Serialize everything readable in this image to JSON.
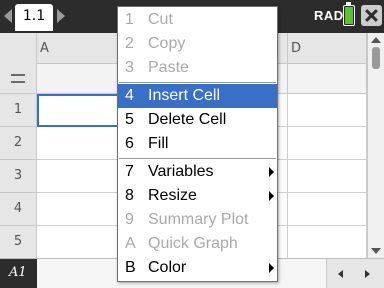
{
  "topbar": {
    "tab_label": "1.1",
    "mode_label": "RAD",
    "battery_color": "#5cc233"
  },
  "sheet": {
    "columns": [
      "A",
      "",
      "",
      "D"
    ],
    "rows": [
      "1",
      "2",
      "3",
      "4",
      "5"
    ],
    "selected_cell": "A1"
  },
  "bottombar": {
    "cell_reference": "A1"
  },
  "menu": {
    "highlight_color": "#3a6fc8",
    "items": [
      {
        "num": "1",
        "label": "Cut",
        "enabled": false
      },
      {
        "num": "2",
        "label": "Copy",
        "enabled": false
      },
      {
        "num": "3",
        "label": "Paste",
        "enabled": false
      },
      {
        "num": "4",
        "label": "Insert Cell",
        "enabled": true,
        "highlighted": true
      },
      {
        "num": "5",
        "label": "Delete Cell",
        "enabled": true
      },
      {
        "num": "6",
        "label": "Fill",
        "enabled": true
      },
      {
        "num": "7",
        "label": "Variables",
        "enabled": true,
        "submenu": true
      },
      {
        "num": "8",
        "label": "Resize",
        "enabled": true,
        "submenu": true
      },
      {
        "num": "9",
        "label": "Summary Plot",
        "enabled": false
      },
      {
        "num": "A",
        "label": "Quick Graph",
        "enabled": false
      },
      {
        "num": "B",
        "label": "Color",
        "enabled": true,
        "submenu": true
      }
    ]
  },
  "icons": {
    "prev_page": "chevron-left-icon",
    "next_page": "chevron-right-icon",
    "close": "close-icon",
    "battery": "battery-icon",
    "formula": "equals-icon"
  }
}
